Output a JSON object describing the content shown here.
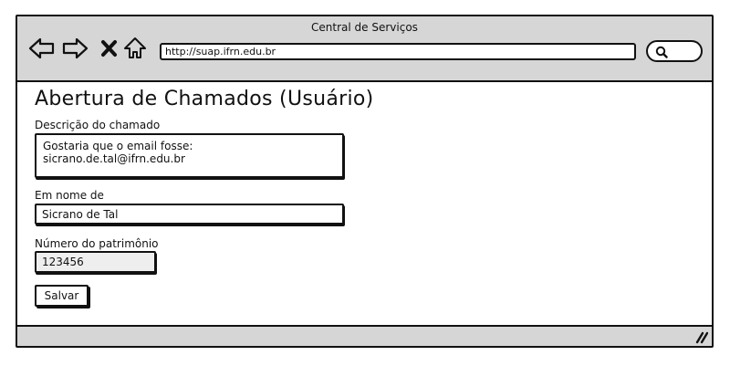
{
  "window": {
    "title": "Central de Serviços"
  },
  "browser": {
    "url": "http://suap.ifrn.edu.br",
    "nav_icons": [
      "back-arrow-icon",
      "forward-arrow-icon",
      "stop-x-icon",
      "home-icon"
    ],
    "search_icon": "search-icon",
    "resize_icon": "resize-grip-icon"
  },
  "page": {
    "title": "Abertura de Chamados (Usuário)"
  },
  "form": {
    "descricao": {
      "label": "Descrição do chamado",
      "value": "Gostaria que o email fosse: sicrano.de.tal@ifrn.edu.br"
    },
    "em_nome_de": {
      "label": "Em nome de",
      "value": "Sicrano de Tal"
    },
    "patrimonio": {
      "label": "Número do patrimônio",
      "value": "123456"
    },
    "submit_label": "Salvar"
  },
  "colors": {
    "chrome_bg": "#d6d6d6",
    "border": "#111111",
    "disabled_field_bg": "#eeeeee"
  }
}
